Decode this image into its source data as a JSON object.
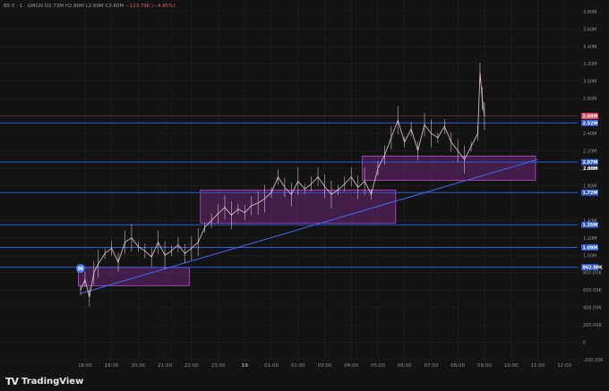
{
  "header": {
    "symbol": "B5·5 · 1 · GMGN",
    "open": "O2.73M",
    "high": "H2.80M",
    "low": "L2.60M",
    "close": "C2.60M",
    "change": "−123.79K (−4.85%)"
  },
  "brand": {
    "logo": "TV",
    "name": "TradingView"
  },
  "colors": {
    "background": "#131313",
    "grid": "#232323",
    "level_line": "#2f5bd8",
    "trendline": "#3f63e6",
    "zone_fill": "#7a2a8a",
    "zone_border": "#c04ad0",
    "candle": "#f0d5d9",
    "marker": "#3b82f6"
  },
  "marker": {
    "label": "M",
    "time": "17:50"
  },
  "chart_data": {
    "type": "line",
    "x_ticks": [
      "18:00",
      "19:00",
      "20:00",
      "21:00",
      "22:00",
      "23:00",
      "19",
      "01:00",
      "02:00",
      "03:00",
      "04:00",
      "05:00",
      "06:00",
      "07:00",
      "08:00",
      "09:00",
      "10:00",
      "11:00",
      "12:00"
    ],
    "y_tick_labels": [
      "3.80M",
      "3.60M",
      "3.40M",
      "3.20M",
      "3.00M",
      "2.80M",
      "2.40M",
      "2.20M",
      "2.00M",
      "1.80M",
      "1.40M",
      "1.20M",
      "1.00M",
      "800.00K",
      "600.00K",
      "400.00K",
      "200.00K",
      "0",
      "-200.00K"
    ],
    "y_tick_values": [
      3800000,
      3600000,
      3400000,
      3200000,
      3000000,
      2800000,
      2400000,
      2200000,
      2000000,
      1800000,
      1400000,
      1200000,
      1000000,
      800000,
      600000,
      400000,
      200000,
      0,
      -200000
    ],
    "ylim": [
      -200000,
      3850000
    ],
    "xlim": [
      "17:30",
      "12:30"
    ],
    "horizontal_levels": [
      {
        "value": 2520000,
        "label": "2.52M"
      },
      {
        "value": 2070000,
        "label": "2.07M"
      },
      {
        "value": 1720000,
        "label": "1.72M"
      },
      {
        "value": 1350000,
        "label": "1.35M"
      },
      {
        "value": 1090000,
        "label": "1.09M"
      },
      {
        "value": 862900,
        "label": "862.90K"
      }
    ],
    "current_price": {
      "value": 2600000,
      "label": "2.60M"
    },
    "price_labels": [
      {
        "value": 2000000,
        "label": "2.00M"
      }
    ],
    "zones": [
      {
        "x_start": "17:45",
        "x_end": "21:55",
        "y_low": 650000,
        "y_high": 860000
      },
      {
        "x_start": "22:20",
        "x_end": "05:40",
        "y_low": 1370000,
        "y_high": 1750000
      },
      {
        "x_start": "04:25",
        "x_end": "10:55",
        "y_low": 1860000,
        "y_high": 2140000
      }
    ],
    "trendline": {
      "start": {
        "x": "17:50",
        "y": 560000
      },
      "end": {
        "x": "11:00",
        "y": 2100000
      }
    },
    "series": [
      {
        "x": [
          "17:50",
          "18:00",
          "18:10",
          "18:20",
          "18:30",
          "18:45",
          "19:00",
          "19:15",
          "19:30",
          "19:45",
          "20:00",
          "20:15",
          "20:30",
          "20:45",
          "21:00",
          "21:15",
          "21:30",
          "21:45",
          "22:00",
          "22:15",
          "22:30",
          "22:45",
          "23:00",
          "23:15",
          "23:30",
          "23:45",
          "00:00",
          "00:15",
          "00:30",
          "00:45",
          "01:00",
          "01:15",
          "01:30",
          "01:45",
          "02:00",
          "02:15",
          "02:30",
          "02:45",
          "03:00",
          "03:15",
          "03:30",
          "03:45",
          "04:00",
          "04:15",
          "04:30",
          "04:45",
          "05:00",
          "05:15",
          "05:30",
          "05:45",
          "06:00",
          "06:15",
          "06:30",
          "06:45",
          "07:00",
          "07:15",
          "07:30",
          "07:45",
          "08:00",
          "08:15",
          "08:30",
          "08:45",
          "08:50",
          "08:55",
          "09:00"
        ],
        "values": [
          600000,
          720000,
          520000,
          800000,
          900000,
          1020000,
          1080000,
          920000,
          1150000,
          1200000,
          1100000,
          1050000,
          980000,
          1150000,
          1000000,
          1050000,
          1120000,
          1020000,
          1080000,
          1150000,
          1320000,
          1400000,
          1480000,
          1550000,
          1460000,
          1530000,
          1490000,
          1570000,
          1600000,
          1650000,
          1720000,
          1900000,
          1780000,
          1700000,
          1850000,
          1760000,
          1820000,
          1900000,
          1790000,
          1700000,
          1750000,
          1820000,
          1900000,
          1780000,
          1850000,
          1700000,
          2000000,
          2150000,
          2350000,
          2550000,
          2300000,
          2450000,
          2200000,
          2500000,
          2400000,
          2350000,
          2480000,
          2300000,
          2200000,
          2100000,
          2250000,
          2400000,
          3100000,
          2800000,
          2600000
        ]
      }
    ]
  }
}
